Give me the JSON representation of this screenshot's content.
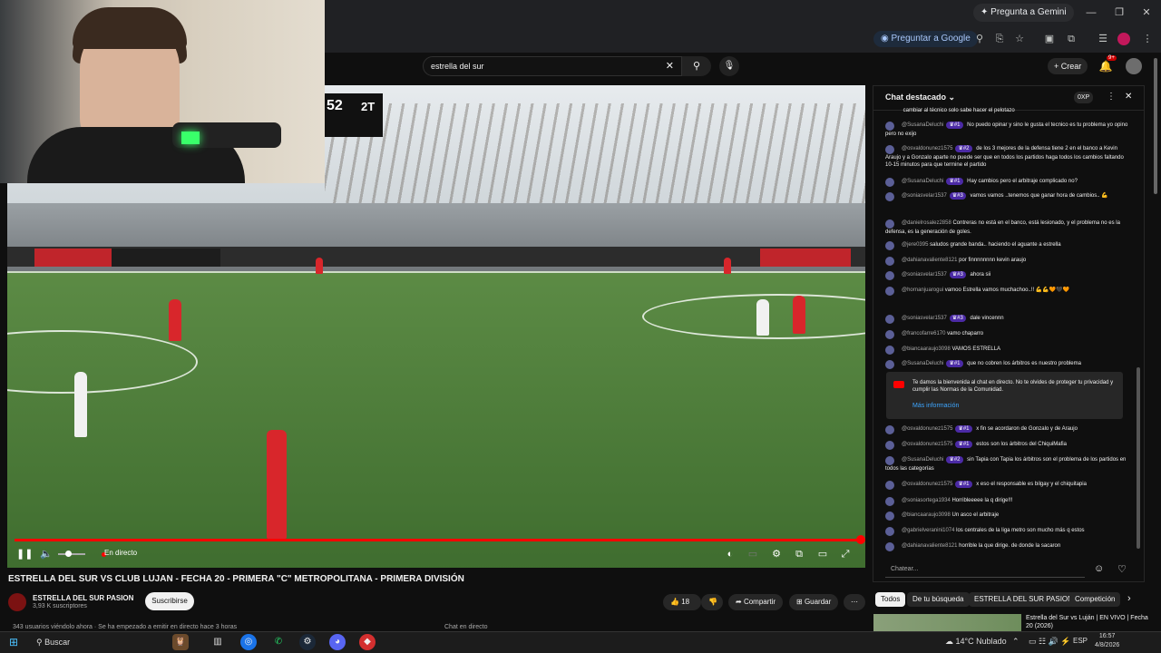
{
  "browser": {
    "gemini_label": "Pregunta a Gemini",
    "ask_google_label": "Preguntar a Google"
  },
  "youtube": {
    "search_value": "estrella del sur",
    "create_label": "Crear",
    "notifications_count": "9+"
  },
  "video": {
    "scoreboard_minute": "52",
    "scoreboard_half": "2T",
    "live_label": "En directo",
    "title": "ESTRELLA DEL SUR VS CLUB LUJAN - FECHA 20 - PRIMERA \"C\" METROPOLITANA - PRIMERA DIVISIÓN",
    "channel_name": "ESTRELLA DEL SUR PASION",
    "channel_subs": "3,93 K suscriptores",
    "subscribe_label": "Suscribirse",
    "likes": "18",
    "share_label": "Compartir",
    "save_label": "Guardar",
    "viewers_text": "343 usuarios viéndolo ahora · Se ha empezado a emitir en directo hace 3 horas",
    "chat_replay_label": "Chat en directo"
  },
  "chat": {
    "title": "Chat destacado",
    "xp_label": "0XP",
    "input_placeholder": "Chatear...",
    "messages": [
      {
        "author": "",
        "badge": "",
        "text": "cambiar al técnico solo sabe hacer el pelotazo"
      },
      {
        "author": "@SusanaDeluchi",
        "badge": "#1",
        "text": "No puedo opinar y sino le gusta el tecnico es tu problema yo opino pero no exijo"
      },
      {
        "author": "@osvaldonunez1575",
        "badge": "#2",
        "text": "de los 3 mejores de la defensa tiene 2 en el banco a Kevin Araujo y a Gonzalo aparte no puede ser que en todos los partidos haga todos los cambios faltando 10-15 minutos para que termine el partido"
      },
      {
        "author": "@SusanaDeluchi",
        "badge": "#1",
        "text": "Hay cambios pero el arbitraje complicado no?"
      },
      {
        "author": "@soniasvelar1537",
        "badge": "#3",
        "text": "vamos vamos ..tenemos que ganar hora de cambios.. 💪"
      },
      {
        "author": "@danielrosalez2858",
        "badge": "",
        "text": "Contreras no está en el banco, está lesionado, y el problema no es la defensa, es la generación de goles."
      },
      {
        "author": "@jere0395",
        "badge": "",
        "text": "saludos grande banda.. haciendo el aguante a estrella"
      },
      {
        "author": "@dahianavaliente8121",
        "badge": "",
        "text": "por finnnnnnnn kevin araujo"
      },
      {
        "author": "@soniasvelar1537",
        "badge": "#3",
        "text": "ahora sii"
      },
      {
        "author": "@hornanjuarogui",
        "badge": "",
        "text": "vamoo Estrella vamos muchachoo..!! 💪💪🧡🖤🧡"
      },
      {
        "author": "@soniasvelar1537",
        "badge": "#3",
        "text": "dale vincennn"
      },
      {
        "author": "@francofarre6170",
        "badge": "",
        "text": "vamo chaparro"
      },
      {
        "author": "@biancaaraujo3098",
        "badge": "",
        "text": "VAMOS ESTRELLA"
      },
      {
        "author": "@SusanaDeluchi",
        "badge": "#1",
        "text": "que no cobren los árbitros es nuestro problema"
      }
    ],
    "notice": "Te damos la bienvenida al chat en directo. No te olvides de proteger tu privacidad y cumplir las Normas de la Comunidad.",
    "notice_link": "Más información",
    "messages2": [
      {
        "author": "@osvaldonunez1575",
        "badge": "#1",
        "text": "x fin se acordaron de Gonzalo y de Araujo"
      },
      {
        "author": "@osvaldonunez1575",
        "badge": "#1",
        "text": "estos son los árbitros del ChiquiMafia"
      },
      {
        "author": "@SusanaDeluchi",
        "badge": "#2",
        "text": "sin Tapia con Tapia los árbitros son el problema de los partidos en todos las categorías"
      },
      {
        "author": "@osvaldonunez1575",
        "badge": "#1",
        "text": "x eso el responsable es bilgay y el chiquitapia"
      },
      {
        "author": "@soniasortega1934",
        "badge": "",
        "text": "Horribleeeee la q dirige!!!"
      },
      {
        "author": "@biancaaraujo3098",
        "badge": "",
        "text": "Un asco el arbitraje"
      },
      {
        "author": "@gabrielveranini1074",
        "badge": "",
        "text": "los centrales de la liga metro son mucho más q estos"
      },
      {
        "author": "@dahianavaliente8121",
        "badge": "",
        "text": "horrible la que dirige. de donde la sacaron"
      }
    ]
  },
  "chips": [
    "Todos",
    "De tu búsqueda",
    "ESTRELLA DEL SUR PASION",
    "Competición"
  ],
  "recommendation_title": "Estrella del Sur vs Luján | EN VIVO | Fecha 20 (2026)",
  "taskbar": {
    "search_label": "Buscar",
    "weather": "14°C  Nublado",
    "lang": "ESP",
    "time": "16:57",
    "date": "4/8/2026"
  }
}
